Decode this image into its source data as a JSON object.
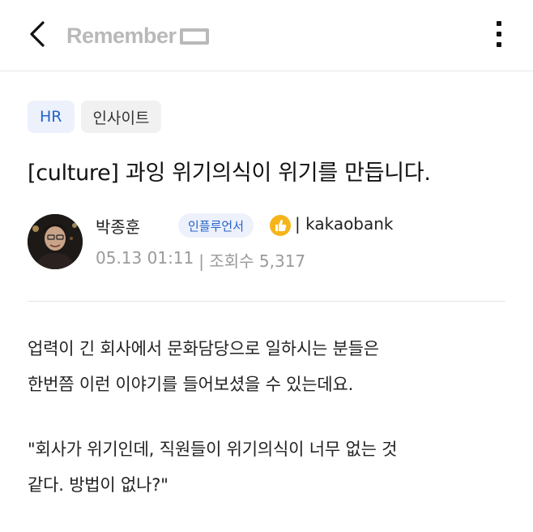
{
  "header": {
    "brand": "Remember",
    "back_icon": "chevron-left-icon",
    "more_icon": "more-vertical-icon"
  },
  "tags": [
    {
      "label": "HR",
      "color": "#2563c9"
    },
    {
      "label": "인사이트"
    }
  ],
  "post": {
    "title": "[culture] 과잉 위기의식이 위기를 만듭니다."
  },
  "author": {
    "name": "박종훈",
    "badge": "인플루언서",
    "badge_icon": "thumbs-up-icon",
    "company": "| kakaobank",
    "date": "05.13 01:11",
    "views": "| 조회수 5,317"
  },
  "body": {
    "paragraphs": [
      [
        "업력이 긴 회사에서 문화담당으로 일하시는 분들은",
        "한번쯤 이런 이야기를 들어보셨을 수 있는데요."
      ],
      [
        "\"회사가 위기인데, 직원들이 위기의식이 너무 없는 것",
        "같다. 방법이 없나?\""
      ]
    ]
  }
}
